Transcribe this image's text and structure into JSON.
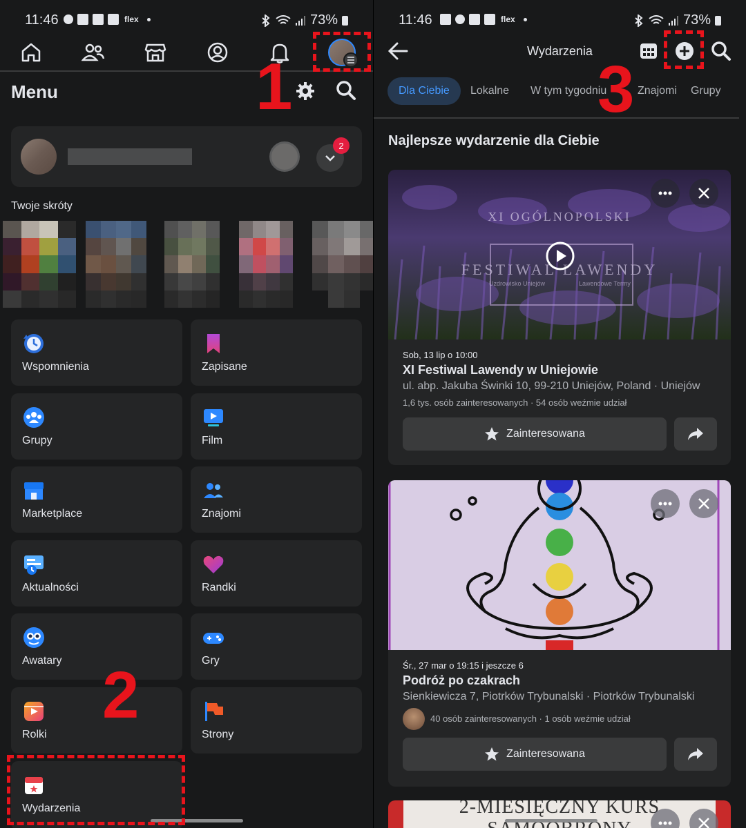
{
  "status_bar": {
    "time": "11:46",
    "carrier": "flex",
    "battery": "73%"
  },
  "left": {
    "menu_title": "Menu",
    "profile": {
      "notification_count": "2"
    },
    "shortcuts_label": "Twoje skróty",
    "tiles": [
      {
        "label": "Wspomnienia",
        "icon": "memories-clock-icon"
      },
      {
        "label": "Zapisane",
        "icon": "bookmark-icon"
      },
      {
        "label": "Grupy",
        "icon": "groups-icon"
      },
      {
        "label": "Film",
        "icon": "video-icon"
      },
      {
        "label": "Marketplace",
        "icon": "marketplace-store-icon"
      },
      {
        "label": "Znajomi",
        "icon": "friends-icon"
      },
      {
        "label": "Aktualności",
        "icon": "feed-icon"
      },
      {
        "label": "Randki",
        "icon": "dating-heart-icon"
      },
      {
        "label": "Awatary",
        "icon": "avatar-icon"
      },
      {
        "label": "Gry",
        "icon": "gamepad-icon"
      },
      {
        "label": "Rolki",
        "icon": "reels-icon"
      },
      {
        "label": "Strony",
        "icon": "flag-icon"
      },
      {
        "label": "Wydarzenia",
        "icon": "calendar-icon"
      }
    ]
  },
  "right": {
    "header_title": "Wydarzenia",
    "chips": [
      "Dla Ciebie",
      "Lokalne",
      "W tym tygodniu",
      "Znajomi",
      "Grupy"
    ],
    "section_title": "Najlepsze wydarzenie dla Ciebie",
    "events": [
      {
        "date": "Sob, 13 lip o 10:00",
        "title": "XI Festiwal Lawendy w Uniejowie",
        "location": "ul. abp. Jakuba Świnki 10, 99-210 Uniejów, Poland · Uniejów",
        "stats": "1,6 tys. osób zainteresowanych · 54 osób weźmie udział",
        "image_text_1": "XI OGÓLNOPOLSKI",
        "image_text_2": "FESTIWAL LAWENDY",
        "image_text_3": "Uzdrowisko Uniejów",
        "image_text_4": "Lawendowe Termy",
        "interest_label": "Zainteresowana"
      },
      {
        "date": "Śr., 27 mar o 19:15 i jeszcze 6",
        "title": "Podróż po czakrach",
        "location": "Sienkiewicza 7, Piotrków Trybunalski · Piotrków Trybunalski",
        "stats": "40 osób zainteresowanych · 1 osób weźmie udział",
        "interest_label": "Zainteresowana"
      },
      {
        "image_text_1": "2-MIESIĘCZNY KURS",
        "image_text_2": "SAMOOBRONY"
      }
    ]
  },
  "annotations": [
    "1",
    "2",
    "3"
  ],
  "colors": {
    "annotation_red": "#e8141c",
    "active_chip_bg": "#263951",
    "active_chip_text": "#4599ff",
    "card_bg": "#242526",
    "page_bg": "#18191a"
  }
}
